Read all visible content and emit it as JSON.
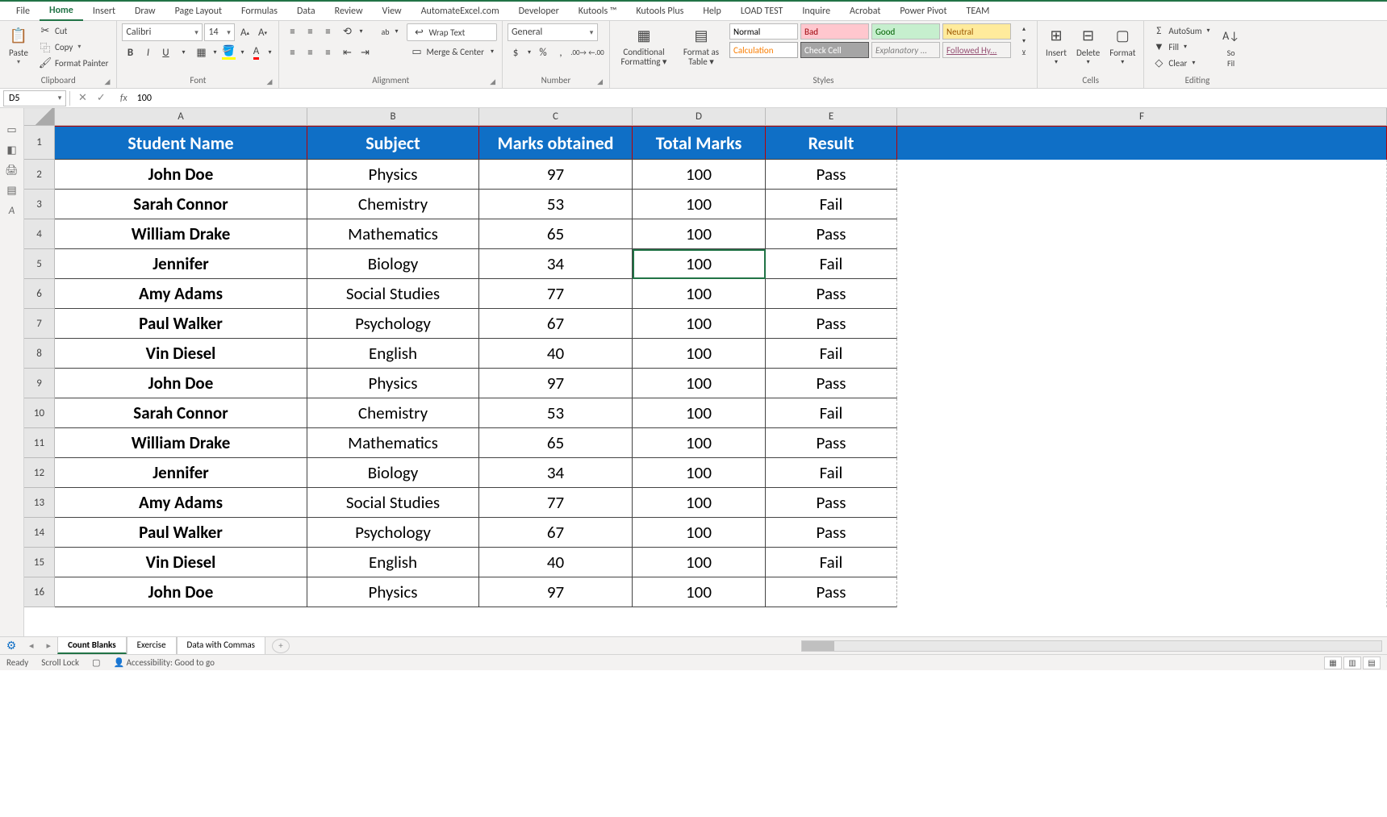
{
  "ribbon_tabs": [
    "File",
    "Home",
    "Insert",
    "Draw",
    "Page Layout",
    "Formulas",
    "Data",
    "Review",
    "View",
    "AutomateExcel.com",
    "Developer",
    "Kutools ™",
    "Kutools Plus",
    "Help",
    "LOAD TEST",
    "Inquire",
    "Acrobat",
    "Power Pivot",
    "TEAM"
  ],
  "active_tab": "Home",
  "clipboard": {
    "paste": "Paste",
    "cut": "Cut",
    "copy": "Copy",
    "format_painter": "Format Painter",
    "label": "Clipboard"
  },
  "font": {
    "name": "Calibri",
    "size": "14",
    "label": "Font"
  },
  "alignment": {
    "wrap": "Wrap Text",
    "merge": "Merge & Center",
    "label": "Alignment"
  },
  "number": {
    "format": "General",
    "label": "Number"
  },
  "styles": {
    "cond": "Conditional Formatting",
    "table": "Format as Table",
    "boxes": [
      {
        "t": "Normal",
        "bg": "#fff",
        "fg": "#000"
      },
      {
        "t": "Bad",
        "bg": "#ffc7ce",
        "fg": "#9c0006"
      },
      {
        "t": "Good",
        "bg": "#c6efce",
        "fg": "#006100"
      },
      {
        "t": "Neutral",
        "bg": "#ffeb9c",
        "fg": "#9c5700"
      },
      {
        "t": "Calculation",
        "bg": "#fff",
        "fg": "#fa7d00",
        "b": "1px solid #aaa"
      },
      {
        "t": "Check Cell",
        "bg": "#a5a5a5",
        "fg": "#fff",
        "b": "1px solid #555"
      },
      {
        "t": "Explanatory ...",
        "bg": "transparent",
        "fg": "#7f7f7f",
        "i": true
      },
      {
        "t": "Followed Hy...",
        "bg": "transparent",
        "fg": "#954f72",
        "u": true
      }
    ],
    "label": "Styles"
  },
  "cells": {
    "insert": "Insert",
    "delete": "Delete",
    "format": "Format",
    "label": "Cells"
  },
  "editing": {
    "autosum": "AutoSum",
    "fill": "Fill",
    "clear": "Clear",
    "sort": "Sort & Filter",
    "label": "Editing"
  },
  "name_box": "D5",
  "formula_value": "100",
  "columns": [
    "A",
    "B",
    "C",
    "D",
    "E",
    "F"
  ],
  "header_row": [
    "Student Name",
    "Subject",
    "Marks obtained",
    "Total Marks",
    "Result"
  ],
  "data_rows": [
    [
      "John Doe",
      "Physics",
      "97",
      "100",
      "Pass"
    ],
    [
      "Sarah Connor",
      "Chemistry",
      "53",
      "100",
      "Fail"
    ],
    [
      "William Drake",
      "Mathematics",
      "65",
      "100",
      "Pass"
    ],
    [
      "Jennifer",
      "Biology",
      "34",
      "100",
      "Fail"
    ],
    [
      "Amy Adams",
      "Social Studies",
      "77",
      "100",
      "Pass"
    ],
    [
      "Paul Walker",
      "Psychology",
      "67",
      "100",
      "Pass"
    ],
    [
      "Vin Diesel",
      "English",
      "40",
      "100",
      "Fail"
    ],
    [
      "John Doe",
      "Physics",
      "97",
      "100",
      "Pass"
    ],
    [
      "Sarah Connor",
      "Chemistry",
      "53",
      "100",
      "Fail"
    ],
    [
      "William Drake",
      "Mathematics",
      "65",
      "100",
      "Pass"
    ],
    [
      "Jennifer",
      "Biology",
      "34",
      "100",
      "Fail"
    ],
    [
      "Amy Adams",
      "Social Studies",
      "77",
      "100",
      "Pass"
    ],
    [
      "Paul Walker",
      "Psychology",
      "67",
      "100",
      "Pass"
    ],
    [
      "Vin Diesel",
      "English",
      "40",
      "100",
      "Fail"
    ],
    [
      "John Doe",
      "Physics",
      "97",
      "100",
      "Pass"
    ]
  ],
  "selected_cell": {
    "row": 5,
    "col": "D"
  },
  "sheet_tabs": [
    "Count Blanks",
    "Exercise",
    "Data with Commas"
  ],
  "active_sheet": "Count Blanks",
  "status": {
    "ready": "Ready",
    "scroll": "Scroll Lock",
    "access": "Accessibility: Good to go"
  }
}
